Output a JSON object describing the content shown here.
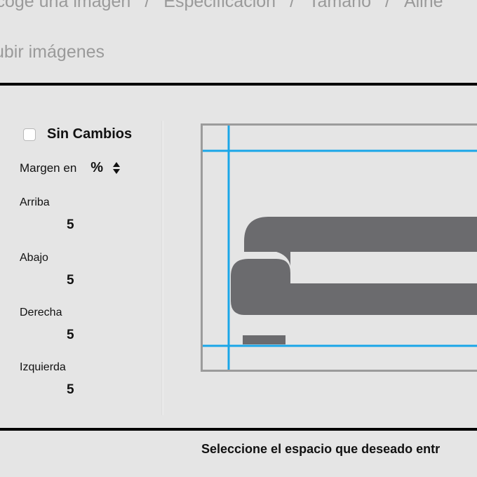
{
  "breadcrumb": {
    "items": [
      "scoge una imagen",
      "Especificación",
      "Tamaño",
      "Aline"
    ],
    "separator": "/"
  },
  "page_subtitle": "ubir imágenes",
  "margins": {
    "no_change_label": "Sin Cambios",
    "no_change_checked": false,
    "unit_label": "Margen en",
    "unit_value": "%",
    "top_label": "Arriba",
    "top_value": "5",
    "bottom_label": "Abajo",
    "bottom_value": "5",
    "right_label": "Derecha",
    "right_value": "5",
    "left_label": "Izquierda",
    "left_value": "5"
  },
  "preview": {
    "image_icon": "sofa-icon",
    "guide_color": "#1aa6e8",
    "frame_color": "#9b9b9b",
    "icon_color": "#6b6b6e"
  },
  "footer": {
    "instruction": "Seleccione el espacio que deseado entr"
  }
}
